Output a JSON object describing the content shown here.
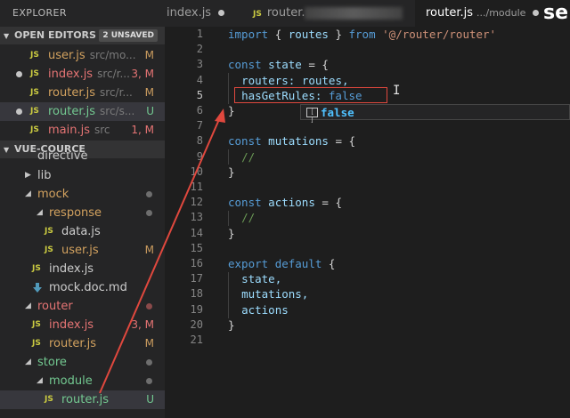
{
  "sidebar": {
    "title": "EXPLORER",
    "open_editors": {
      "heading": "OPEN EDITORS",
      "badge": "2 UNSAVED",
      "items": [
        {
          "lang": "JS",
          "name": "user.js",
          "sub": "src/mo...",
          "status": "M"
        },
        {
          "lang": "JS",
          "name": "index.js",
          "sub": "src/r...",
          "status": "3, M"
        },
        {
          "lang": "JS",
          "name": "router.js",
          "sub": "src/r...",
          "status": "M"
        },
        {
          "lang": "JS",
          "name": "router.js",
          "sub": "src/s...",
          "status": "U"
        },
        {
          "lang": "JS",
          "name": "main.js",
          "sub": "src",
          "status": "1, M"
        }
      ]
    },
    "project": {
      "heading": "VUE-COURCE",
      "items": [
        {
          "name": "directive"
        },
        {
          "name": "lib"
        },
        {
          "name": "mock"
        },
        {
          "name": "response"
        },
        {
          "lang": "JS",
          "name": "data.js"
        },
        {
          "lang": "JS",
          "name": "user.js",
          "status": "M"
        },
        {
          "lang": "JS",
          "name": "index.js"
        },
        {
          "name": "mock.doc.md"
        },
        {
          "name": "router"
        },
        {
          "lang": "JS",
          "name": "index.js",
          "status": "3, M"
        },
        {
          "lang": "JS",
          "name": "router.js",
          "status": "M"
        },
        {
          "name": "store"
        },
        {
          "name": "module"
        },
        {
          "lang": "JS",
          "name": "router.js",
          "status": "U"
        }
      ]
    }
  },
  "tabs": [
    {
      "name": "index.js"
    },
    {
      "lang": "JS",
      "name": "router."
    },
    {
      "name": "router.js",
      "sub": ".../module"
    }
  ],
  "search_fragment": "se",
  "editor": {
    "lines": [
      {
        "n": "1"
      },
      {
        "n": "2"
      },
      {
        "n": "3"
      },
      {
        "n": "4"
      },
      {
        "n": "5"
      },
      {
        "n": "6"
      },
      {
        "n": "7"
      },
      {
        "n": "8"
      },
      {
        "n": "9"
      },
      {
        "n": "10"
      },
      {
        "n": "11"
      },
      {
        "n": "12"
      },
      {
        "n": "13"
      },
      {
        "n": "14"
      },
      {
        "n": "15"
      },
      {
        "n": "16"
      },
      {
        "n": "17"
      },
      {
        "n": "18"
      },
      {
        "n": "19"
      },
      {
        "n": "20"
      },
      {
        "n": "21"
      }
    ],
    "t": {
      "import": "import",
      "lb": "{",
      "routes": "routes",
      "rb": "}",
      "from": "from",
      "path": "'@/router/router'",
      "const": "const",
      "state": "state",
      "eq": "=",
      "routers_key": "routers:",
      "routes_val": "routes,",
      "hasGetRules": "hasGetRules:",
      "false": "false",
      "mutations": "mutations",
      "actions": "actions",
      "comment": "//",
      "export": "export",
      "default": "default",
      "state_c": "state,",
      "mutations_c": "mutations,",
      "actions_v": "actions"
    },
    "autocomplete": {
      "icon": "[ ]",
      "text": "false"
    },
    "cursor": "I"
  },
  "colors": {
    "annotation": "#e0483e",
    "keyword": "#569cd6",
    "variable": "#9cdcfe",
    "string": "#ce9178",
    "comment": "#6a9955"
  }
}
